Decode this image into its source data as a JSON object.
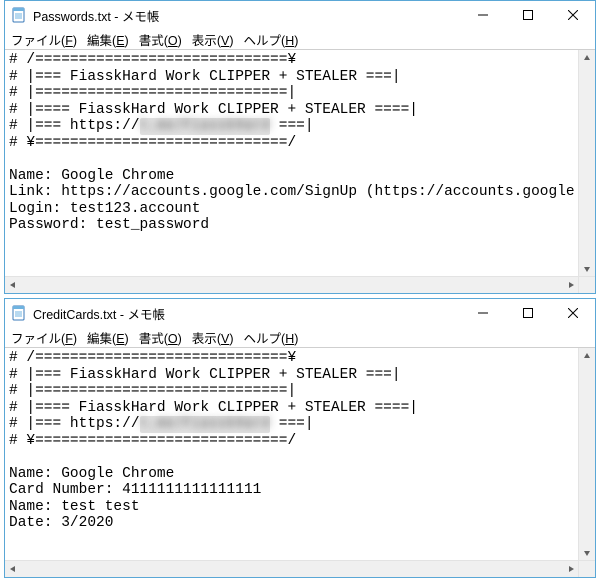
{
  "menu": {
    "file": {
      "label": "ファイル",
      "key": "F"
    },
    "edit": {
      "label": "編集",
      "key": "E"
    },
    "format": {
      "label": "書式",
      "key": "O"
    },
    "view": {
      "label": "表示",
      "key": "V"
    },
    "help": {
      "label": "ヘルプ",
      "key": "H"
    }
  },
  "windows": [
    {
      "title": "Passwords.txt - メモ帳",
      "banner": {
        "l1": "# /=============================¥",
        "l2": "# |=== FiasskHard Work CLIPPER + STEALER ===|",
        "l3": "# |=============================|",
        "l4": "# |==== FiasskHard Work CLIPPER + STEALER ====|",
        "l5a": "# |=== https://",
        "l5blur": "t.me/FiasskHard",
        "l5b": " ===|",
        "l6": "# ¥=============================/"
      },
      "record": {
        "r1": "Name: Google Chrome",
        "r2": "Link: https://accounts.google.com/SignUp (https://accounts.google.com/)",
        "r3": "Login: test123.account",
        "r4": "Password: test_password"
      }
    },
    {
      "title": "CreditCards.txt - メモ帳",
      "banner": {
        "l1": "# /=============================¥",
        "l2": "# |=== FiasskHard Work CLIPPER + STEALER ===|",
        "l3": "# |=============================|",
        "l4": "# |==== FiasskHard Work CLIPPER + STEALER ====|",
        "l5a": "# |=== https://",
        "l5blur": "t.me/FiasskHard",
        "l5b": " ===|",
        "l6": "# ¥=============================/"
      },
      "record": {
        "r1": "Name: Google Chrome",
        "r2": "Card Number: 4111111111111111",
        "r3": "Name: test test",
        "r4": "Date: 3/2020"
      }
    }
  ]
}
